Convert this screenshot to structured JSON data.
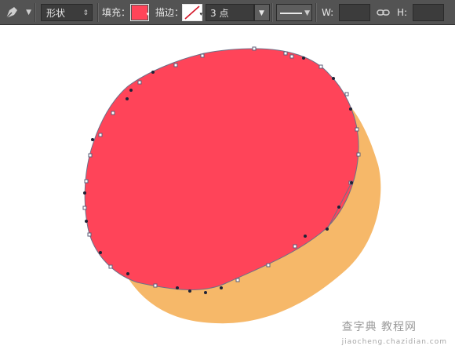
{
  "toolbar": {
    "tool_icon": "pen-tool-icon",
    "mode_value": "形状",
    "fill_label": "填充：",
    "fill_color": "#ff4459",
    "stroke_label": "描边：",
    "stroke_size_value": "3 点",
    "width_label": "W:",
    "height_label": "H:",
    "link_icon": "link-icon"
  },
  "canvas": {
    "shapes": [
      {
        "name": "orange-blob-shape",
        "color": "#f6b869"
      },
      {
        "name": "red-blob-shape",
        "color": "#ff4459"
      }
    ]
  },
  "watermark": {
    "main": "查字典 教程网",
    "sub": "jiaocheng.chazidian.com"
  }
}
